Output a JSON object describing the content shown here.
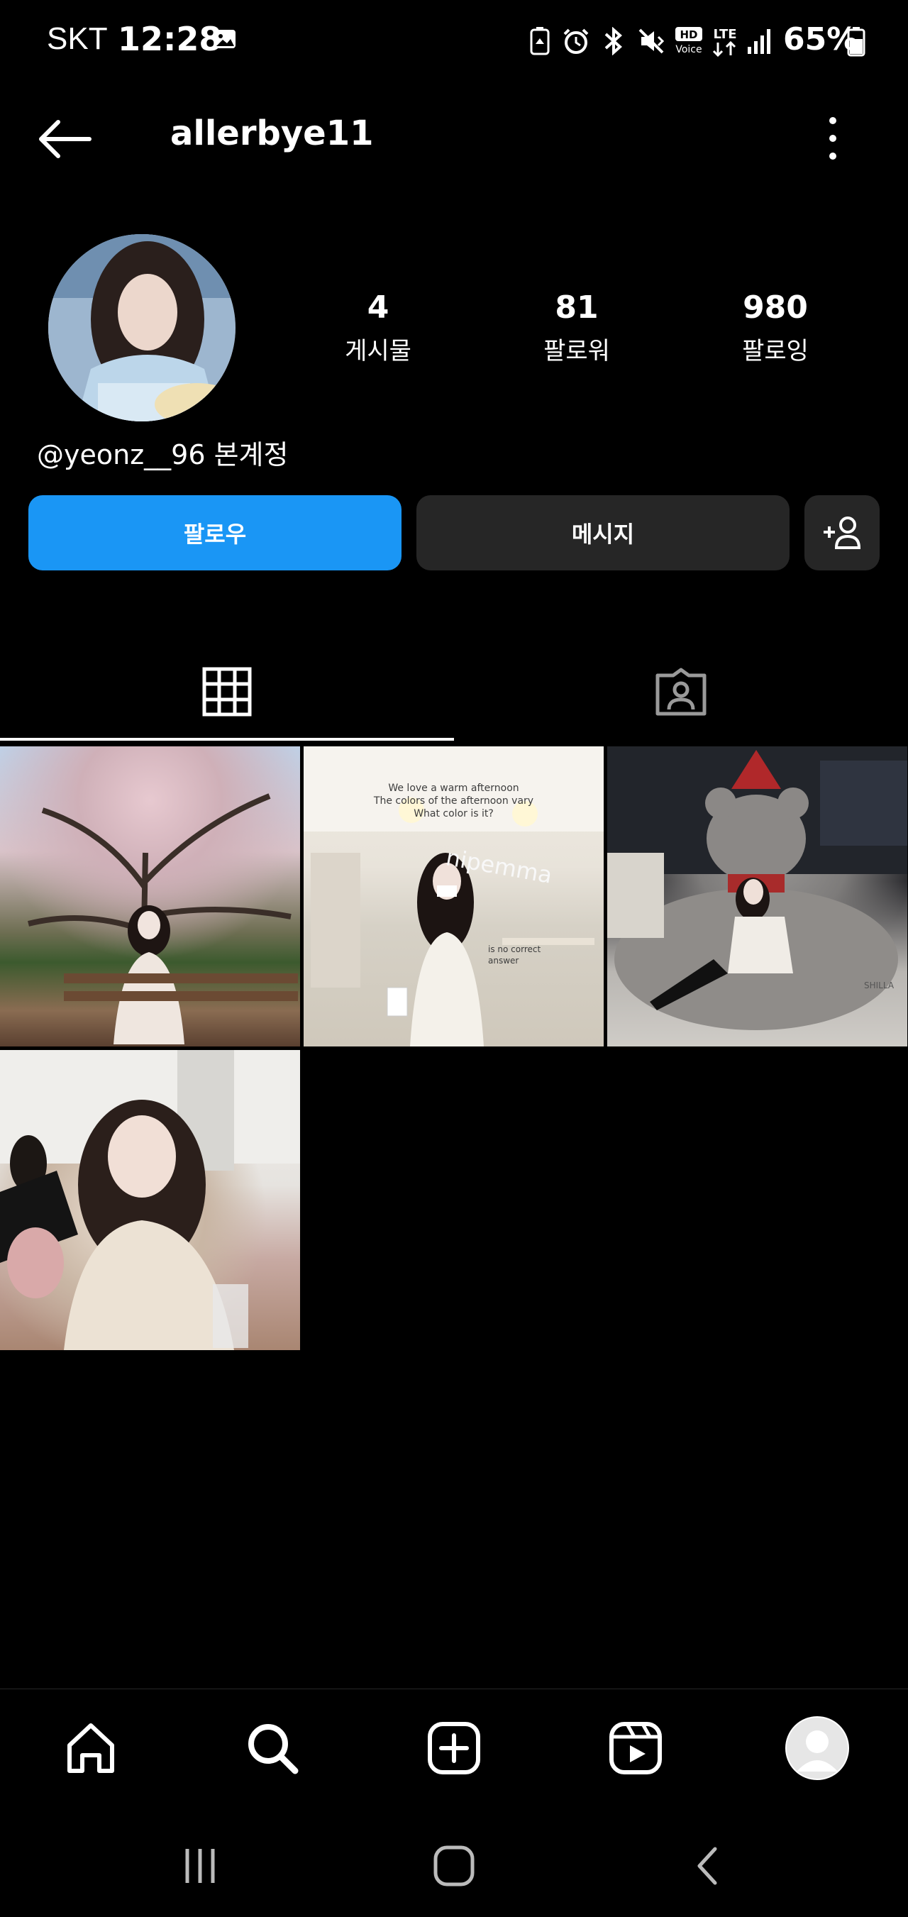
{
  "status_bar": {
    "carrier": "SKT",
    "time": "12:28",
    "battery_percent": "65%",
    "icons": [
      "image-icon",
      "recycle-icon",
      "alarm-icon",
      "bluetooth-icon",
      "mute-icon",
      "hd-voice-icon",
      "lte-icon",
      "signal-icon",
      "battery-icon"
    ]
  },
  "top_bar": {
    "back_icon": "arrow-left-icon",
    "username": "allerbye11",
    "more_icon": "more-vertical-icon"
  },
  "profile": {
    "stats": [
      {
        "number": "4",
        "label": "게시물"
      },
      {
        "number": "81",
        "label": "팔로워"
      },
      {
        "number": "980",
        "label": "팔로잉"
      }
    ],
    "bio": "@yeonz__96 본계정"
  },
  "actions": {
    "follow": "팔로우",
    "message": "메시지"
  },
  "tabs": {
    "grid_icon": "grid-icon",
    "tagged_icon": "tagged-user-icon"
  },
  "posts": [
    {
      "overlay": []
    },
    {
      "overlay": [
        "We love a warm afternoon",
        "The colors of the afternoon vary",
        "What color is it?"
      ],
      "brand": "nipemma",
      "caption": [
        "is no correct",
        "answer"
      ]
    },
    {
      "overlay": [],
      "brand": "SHILLA"
    },
    {
      "overlay": []
    }
  ],
  "colors": {
    "accent": "#1a96f5",
    "button_secondary": "#262626",
    "background": "#000000"
  }
}
